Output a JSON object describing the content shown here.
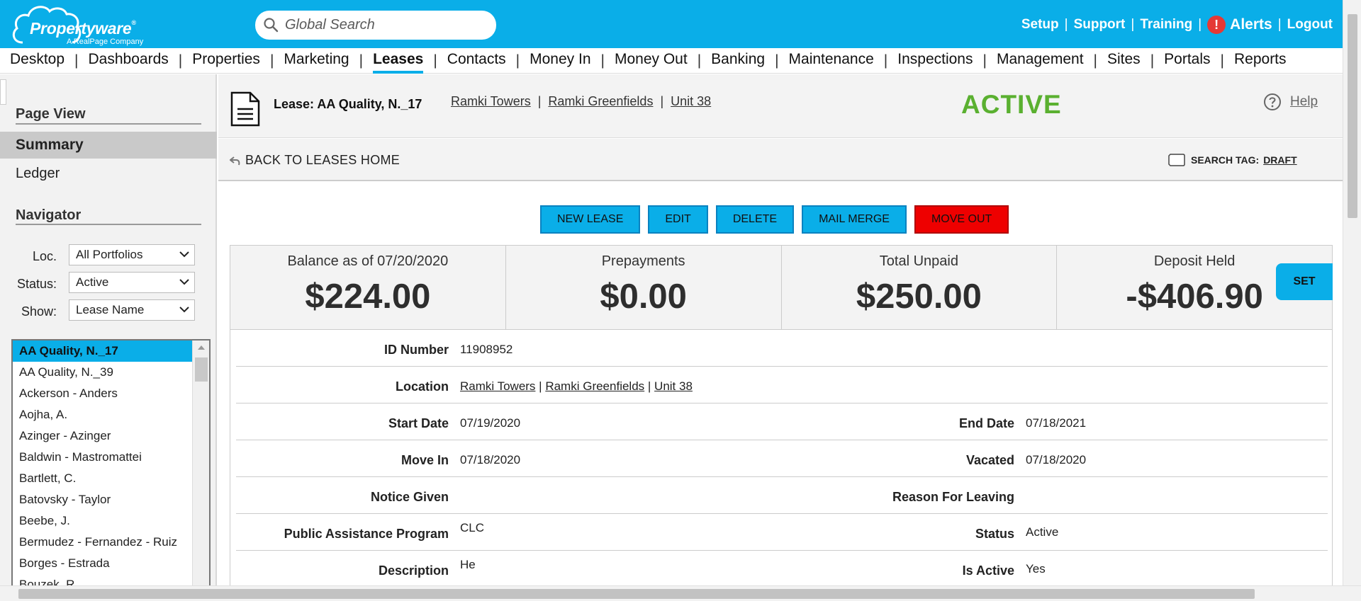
{
  "brand": {
    "name": "Propertyware",
    "tagline": "A RealPage Company"
  },
  "search": {
    "placeholder": "Global Search"
  },
  "top_links": {
    "setup": "Setup",
    "support": "Support",
    "training": "Training",
    "alerts": "Alerts",
    "logout": "Logout",
    "separator": "|"
  },
  "main_nav": {
    "items": [
      "Desktop",
      "Dashboards",
      "Properties",
      "Marketing",
      "Leases",
      "Contacts",
      "Money In",
      "Money Out",
      "Banking",
      "Maintenance",
      "Inspections",
      "Management",
      "Sites",
      "Portals",
      "Reports"
    ],
    "active": "Leases",
    "separator": "|"
  },
  "sidebar": {
    "page_view_heading": "Page View",
    "summary": "Summary",
    "ledger": "Ledger",
    "navigator_heading": "Navigator",
    "loc_label": "Loc.",
    "loc_value": "All Portfolios",
    "status_label": "Status:",
    "status_value": "Active",
    "show_label": "Show:",
    "show_value": "Lease Name",
    "leases": [
      "AA Quality, N._17",
      "AA Quality, N._39",
      "Ackerson - Anders",
      "Aojha, A.",
      "Azinger - Azinger",
      "Baldwin - Mastromattei",
      "Bartlett, C.",
      "Batovsky - Taylor",
      "Beebe, J.",
      "Bermudez - Fernandez - Ruiz",
      "Borges - Estrada",
      "Bouzek, R."
    ],
    "selected_lease": "AA Quality, N._17"
  },
  "lease": {
    "title": "Lease: AA Quality, N._17",
    "breadcrumb": [
      "Ramki Towers",
      "Ramki Greenfields",
      "Unit 38"
    ],
    "status": "ACTIVE",
    "help": "Help",
    "back": "BACK TO LEASES HOME",
    "search_tag_label": "SEARCH TAG:",
    "search_tag_value": "DRAFT"
  },
  "actions": [
    "NEW LEASE",
    "EDIT",
    "DELETE",
    "MAIL MERGE",
    "MOVE OUT"
  ],
  "summary_tiles": [
    {
      "label": "Balance as of 07/20/2020",
      "value": "$224.00"
    },
    {
      "label": "Prepayments",
      "value": "$0.00"
    },
    {
      "label": "Total Unpaid",
      "value": "$250.00"
    },
    {
      "label": "Deposit Held",
      "value": "-$406.90"
    }
  ],
  "set_button": "SET",
  "details": {
    "id_label": "ID Number",
    "id_value": "11908952",
    "location_label": "Location",
    "start_label": "Start Date",
    "start_value": "07/19/2020",
    "end_label": "End Date",
    "end_value": "07/18/2021",
    "movein_label": "Move In",
    "movein_value": "07/18/2020",
    "vacated_label": "Vacated",
    "vacated_value": "07/18/2020",
    "notice_label": "Notice Given",
    "notice_value": "",
    "reason_label": "Reason For Leaving",
    "reason_value": "",
    "assist_label": "Public Assistance Program",
    "assist_value": "CLC",
    "status_label": "Status",
    "status_value": "Active",
    "desc_label": "Description",
    "desc_value": "He",
    "isactive_label": "Is Active",
    "isactive_value": "Yes"
  },
  "colors": {
    "brand_blue": "#0aaee8",
    "active_green": "#5ab030",
    "danger_red": "#ee0000"
  }
}
